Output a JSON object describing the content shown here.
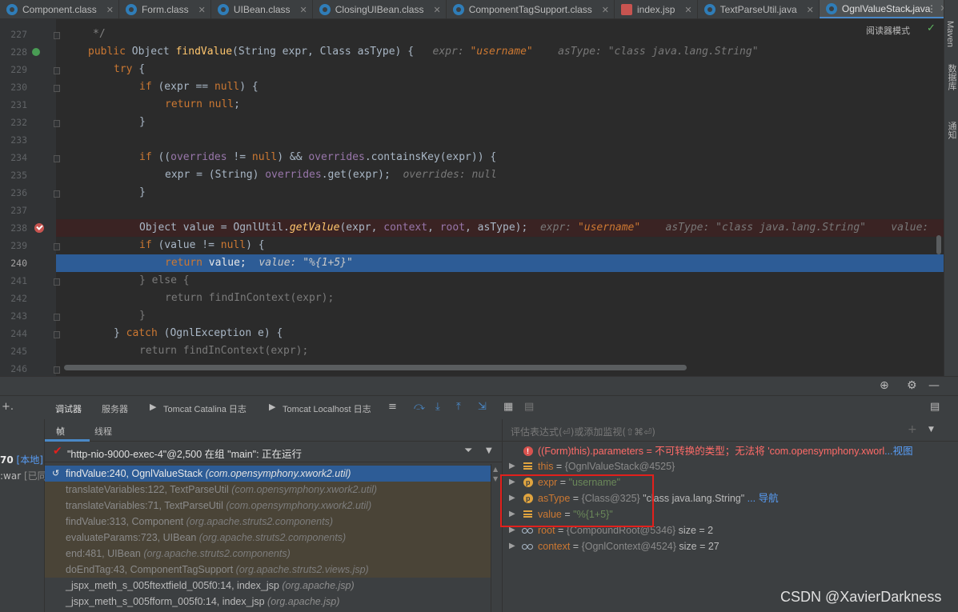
{
  "tabs": [
    {
      "label": "Component.class",
      "icon": "class-icon"
    },
    {
      "label": "Form.class",
      "icon": "class-icon"
    },
    {
      "label": "UIBean.class",
      "icon": "class-icon"
    },
    {
      "label": "ClosingUIBean.class",
      "icon": "class-icon"
    },
    {
      "label": "ComponentTagSupport.class",
      "icon": "class-icon"
    },
    {
      "label": "index.jsp",
      "icon": "jsp-icon"
    },
    {
      "label": "TextParseUtil.java",
      "icon": "class-icon"
    },
    {
      "label": "OgnlValueStack.java",
      "icon": "class-icon",
      "active": true
    }
  ],
  "editor": {
    "reader_mode": "阅读器模式",
    "line_numbers": [
      "227",
      "228",
      "229",
      "230",
      "231",
      "232",
      "233",
      "234",
      "235",
      "236",
      "237",
      "238",
      "239",
      "240",
      "241",
      "242",
      "243",
      "244",
      "245",
      "246"
    ],
    "current_line": "240",
    "l227": "*/",
    "l228_kw": "public",
    "l228_a": " Object ",
    "l228_m": "findValue",
    "l228_b": "(String expr, Class asType) {",
    "l228_h1": "expr: ",
    "l228_h1v": "\"username\"",
    "l228_h2": "asType: \"class java.lang.String\"",
    "l229": "try",
    "l229b": " {",
    "l238_a": "Object value = OgnlUtil.",
    "l238_m": "getValue",
    "l238_b": "(expr, ",
    "l238_f1": "context",
    "l238_f2": "root",
    "l238_c": ", asType);",
    "l238_h1": "expr: ",
    "l238_h1v": "\"username\"",
    "l238_h2": "asType: \"class java.lang.String\"",
    "l238_h3": "value:",
    "l240_kw": "return",
    "l240_a": " value;",
    "l240_h": "value: \"%{1+5}\"",
    "l235_h": "overrides: null",
    "l241": "} else {",
    "l242": "return findInContext(expr);",
    "l244_a": "} ",
    "l244_kw": "catch",
    "l244_b": " (OgnlException e) {",
    "l245": "return findInContext(expr);"
  },
  "right_strip": {
    "maven": "Maven",
    "database": "数据库",
    "notifications": "通知"
  },
  "debug_tabs": {
    "debugger": "调试器",
    "services": "服务器",
    "catalina": "Tomcat Catalina 日志",
    "localhost": "Tomcat Localhost 日志"
  },
  "frames_tabs": {
    "frames": "帧",
    "threads": "线程"
  },
  "left_strip": {
    "t1": "70",
    "t1b": "[本地]",
    "t2": ":war",
    "t2b": "[已同"
  },
  "thread": "\"http-nio-9000-exec-4\"@2,500 在组 \"main\": 正在运行",
  "frames": [
    {
      "m": "findValue:240, OgnlValueStack",
      "p": "(com.opensymphony.xwork2.util)",
      "kind": "sel"
    },
    {
      "m": "translateVariables:122, TextParseUtil",
      "p": "(com.opensymphony.xwork2.util)",
      "kind": "lib"
    },
    {
      "m": "translateVariables:71, TextParseUtil",
      "p": "(com.opensymphony.xwork2.util)",
      "kind": "lib"
    },
    {
      "m": "findValue:313, Component",
      "p": "(org.apache.struts2.components)",
      "kind": "lib"
    },
    {
      "m": "evaluateParams:723, UIBean",
      "p": "(org.apache.struts2.components)",
      "kind": "lib"
    },
    {
      "m": "end:481, UIBean",
      "p": "(org.apache.struts2.components)",
      "kind": "lib"
    },
    {
      "m": "doEndTag:43, ComponentTagSupport",
      "p": "(org.apache.struts2.views.jsp)",
      "kind": "lib"
    },
    {
      "m": "_jspx_meth_s_005ftextfield_005f0:14, index_jsp",
      "p": "(org.apache.jsp)",
      "kind": "norm"
    },
    {
      "m": "_jspx_meth_s_005fform_005f0:14, index_jsp",
      "p": "(org.apache.jsp)",
      "kind": "norm"
    }
  ],
  "eval_placeholder": "评估表达式(⏎)或添加监视(⇧⌘⏎)",
  "variables": {
    "err_name": "((Form)this).parameters",
    "err_val": " = 不可转换的类型；无法将 'com.opensymphony.xworl",
    "err_link": "...视图",
    "this_name": "this",
    "this_val": "{OgnlValueStack@4525}",
    "expr_name": "expr",
    "expr_val": "\"username\"",
    "asType_name": "asType",
    "asType_val": "{Class@325}",
    "asType_str": " \"class java.lang.String\"",
    "asType_link": "... 导航",
    "value_name": "value",
    "value_val": "\"%{1+5}\"",
    "root_name": "root",
    "root_val": "{CompoundRoot@5346}",
    "root_size": " size = 2",
    "context_name": "context",
    "context_val": "{OgnlContext@4524}",
    "context_size": " size = 27"
  },
  "watermark": "CSDN @XavierDarkness",
  "colors": {
    "accent": "#4a88c7",
    "execution_line": "#2d5c96",
    "breakpoint": "#c75450",
    "highlight_box": "#e2201c"
  }
}
